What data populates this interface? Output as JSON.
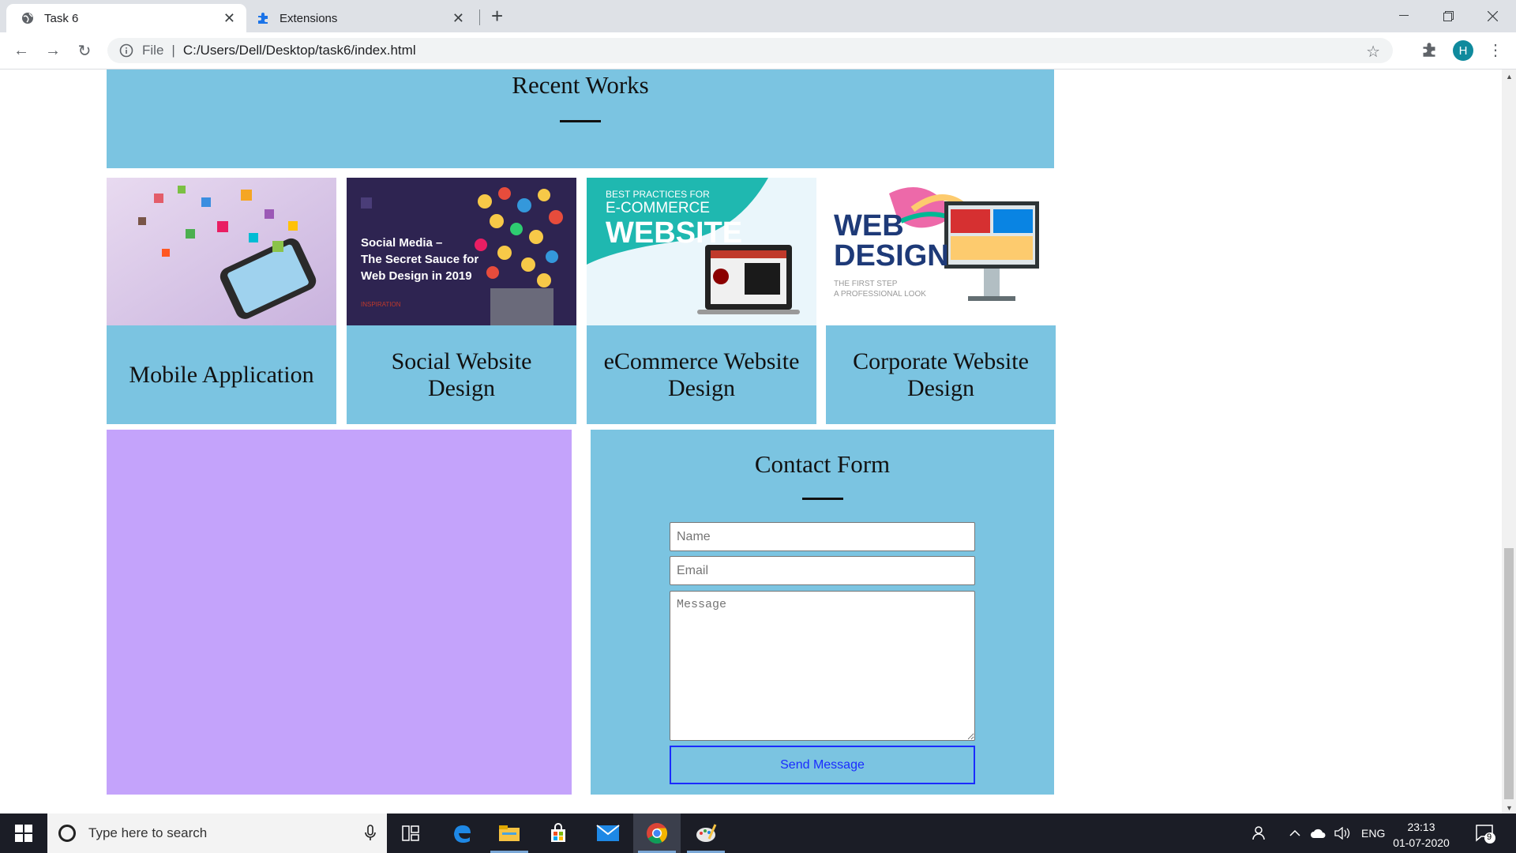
{
  "browser": {
    "tabs": [
      {
        "title": "Task 6",
        "active": true
      },
      {
        "title": "Extensions",
        "active": false
      }
    ],
    "address": {
      "scheme_label": "File",
      "url": "C:/Users/Dell/Desktop/task6/index.html"
    },
    "profile_initial": "H"
  },
  "page": {
    "recent_works": {
      "heading": "Recent Works",
      "cards": [
        {
          "title": "Mobile Application"
        },
        {
          "title": "Social Website Design",
          "image_text": [
            "Social Media –",
            "The Secret Sauce for",
            "Web Design in 2019",
            "INSPIRATION"
          ]
        },
        {
          "title": "eCommerce Website Design",
          "image_text": [
            "BEST PRACTICES FOR",
            "E-COMMERCE",
            "WEBSITE"
          ]
        },
        {
          "title": "Corporate Website Design",
          "image_text": [
            "WEB",
            "DESIGN",
            "THE FIRST STEP",
            "A PROFESSIONAL LOOK"
          ]
        }
      ]
    },
    "contact": {
      "heading": "Contact Form",
      "name_placeholder": "Name",
      "email_placeholder": "Email",
      "message_placeholder": "Message",
      "send_label": "Send Message"
    },
    "colors": {
      "panel": "#7bc4e1",
      "purple": "#c4a3fb",
      "button_border": "#1a2cff"
    }
  },
  "taskbar": {
    "search_placeholder": "Type here to search",
    "language": "ENG",
    "time": "23:13",
    "date": "01-07-2020",
    "notification_count": "9"
  }
}
